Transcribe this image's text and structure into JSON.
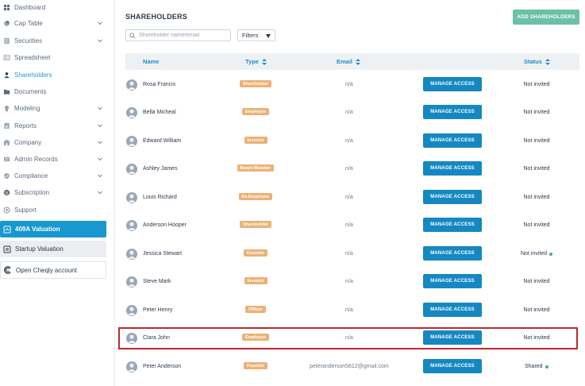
{
  "sidebar": {
    "items": [
      {
        "label": "Dashboard",
        "icon": "dashboard-icon",
        "chevron": false
      },
      {
        "label": "Cap Table",
        "icon": "cap-table-icon",
        "chevron": true
      },
      {
        "label": "Securities",
        "icon": "securities-icon",
        "chevron": true
      },
      {
        "label": "Spreadsheet",
        "icon": "spreadsheet-icon",
        "chevron": false
      },
      {
        "label": "Shareholders",
        "icon": "shareholders-icon",
        "chevron": false,
        "active": true
      },
      {
        "label": "Documents",
        "icon": "documents-icon",
        "chevron": false
      },
      {
        "label": "Modeling",
        "icon": "modeling-icon",
        "chevron": true
      },
      {
        "label": "Reports",
        "icon": "reports-icon",
        "chevron": true
      },
      {
        "label": "Company",
        "icon": "company-icon",
        "chevron": true
      },
      {
        "label": "Admin Records",
        "icon": "admin-records-icon",
        "chevron": true
      },
      {
        "label": "Compliance",
        "icon": "compliance-icon",
        "chevron": true
      },
      {
        "label": "Subscription",
        "icon": "subscription-icon",
        "chevron": true
      },
      {
        "label": "Support",
        "icon": "support-icon",
        "chevron": false
      }
    ],
    "valuation_409a": "409A Valuation",
    "startup_valuation": "Startup Valuation",
    "open_cheqly": "Open Cheqly account"
  },
  "main": {
    "title": "SHAREHOLDERS",
    "add_button": "ADD SHAREHOLDERS",
    "search_placeholder": "Shareholder name/email",
    "filters_label": "Filters",
    "columns": {
      "name": "Name",
      "type": "Type",
      "email": "Email",
      "status": "Status"
    },
    "manage_label": "MANAGE ACCESS",
    "rows": [
      {
        "name": "Rosa Francis",
        "type": "Shareholder",
        "email": "n/a",
        "status": "Not invited",
        "dot": false
      },
      {
        "name": "Bella Micheal",
        "type": "Employee",
        "email": "n/a",
        "status": "Not invited",
        "dot": false
      },
      {
        "name": "Edward William",
        "type": "Investor",
        "email": "n/a",
        "status": "Not invited",
        "dot": false
      },
      {
        "name": "Ashley James",
        "type": "Board Member",
        "email": "n/a",
        "status": "Not invited",
        "dot": false
      },
      {
        "name": "Louis Richard",
        "type": "Ex-Employee",
        "email": "n/a",
        "status": "Not invited",
        "dot": false
      },
      {
        "name": "Anderson Hooper",
        "type": "Shareholder",
        "email": "n/a",
        "status": "Not invited",
        "dot": false
      },
      {
        "name": "Jessica Stewart",
        "type": "Founder",
        "email": "n/a",
        "status": "Not invited",
        "dot": true
      },
      {
        "name": "Steve Mark",
        "type": "Investor",
        "email": "n/a",
        "status": "Not invited",
        "dot": false
      },
      {
        "name": "Peter Henry",
        "type": "Officer",
        "email": "n/a",
        "status": "Not invited",
        "dot": false
      },
      {
        "name": "Clara John",
        "type": "Employee",
        "email": "n/a",
        "status": "Not invited",
        "dot": false,
        "highlighted": true
      },
      {
        "name": "Peter Anderson",
        "type": "Founder",
        "email": "peteranderson5812@gmail.com",
        "status": "Shared",
        "dot": true
      }
    ]
  },
  "colors": {
    "accent": "#1798cf",
    "manage_button": "#1588c2",
    "add_button": "#6cc0a7",
    "badge": "#eab277",
    "highlight_border": "#c0282e",
    "status_dot": "#3fb28b"
  }
}
